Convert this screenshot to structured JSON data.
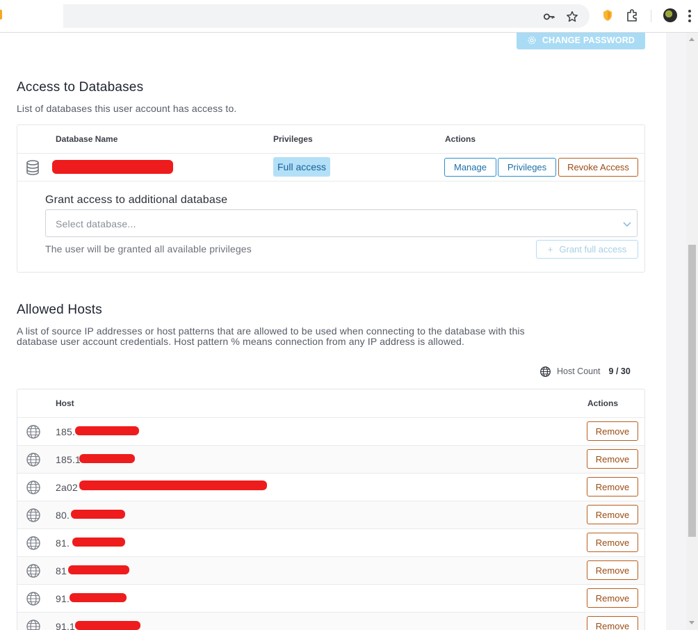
{
  "browser": {
    "icons": [
      "key-icon",
      "star-icon",
      "extension-shield-icon",
      "puzzle-icon",
      "profile-avatar",
      "kebab-menu-icon"
    ]
  },
  "header": {
    "change_password_label": "CHANGE PASSWORD"
  },
  "databases": {
    "title": "Access to Databases",
    "description": "List of databases this user account has access to.",
    "columns": {
      "name": "Database Name",
      "privileges": "Privileges",
      "actions": "Actions"
    },
    "rows": [
      {
        "privilege": "Full access",
        "actions": {
          "manage": "Manage",
          "privileges": "Privileges",
          "revoke": "Revoke Access"
        }
      }
    ],
    "grant": {
      "label": "Grant access to additional database",
      "placeholder": "Select database...",
      "note": "The user will be granted all available privileges",
      "button": "Grant full access"
    }
  },
  "hosts": {
    "title": "Allowed Hosts",
    "description_line1": "A list of source IP addresses or host patterns that are allowed to be used when connecting to the database with this",
    "description_line2": "database user account credentials. Host pattern % means connection from any IP address is allowed.",
    "count_label": "Host Count",
    "count_value": "9 / 30",
    "columns": {
      "host": "Host",
      "actions": "Actions"
    },
    "rows": [
      {
        "host": "185.",
        "action": "Remove"
      },
      {
        "host": "185.1",
        "action": "Remove"
      },
      {
        "host": "2a02",
        "action": "Remove"
      },
      {
        "host": "80.",
        "action": "Remove"
      },
      {
        "host": "81.",
        "action": "Remove"
      },
      {
        "host": "81",
        "action": "Remove"
      },
      {
        "host": "91.",
        "action": "Remove"
      },
      {
        "host": "91.1",
        "action": "Remove"
      }
    ]
  },
  "colors": {
    "primary": "#2b8ecf",
    "danger": "#b85d1a",
    "badge_bg": "#b3e0f7",
    "redaction": "#ee1c1c"
  }
}
